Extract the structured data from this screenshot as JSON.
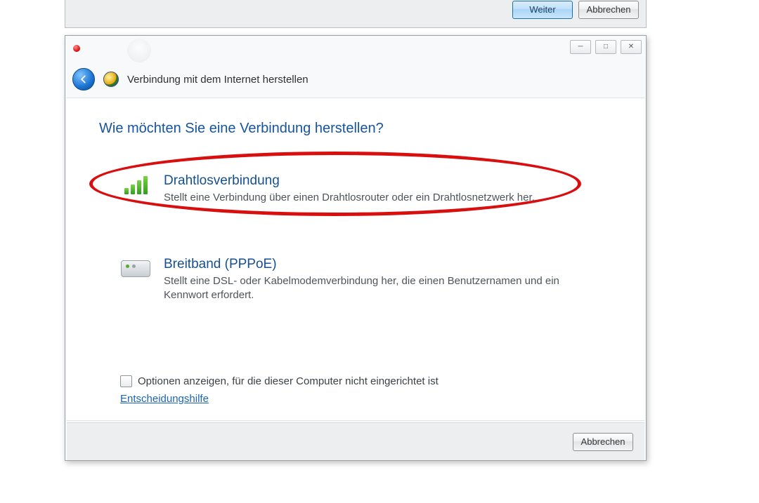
{
  "background_dialog": {
    "next_label": "Weiter",
    "cancel_label": "Abbrechen"
  },
  "wizard": {
    "title": "Verbindung mit dem Internet herstellen",
    "question": "Wie möchten Sie eine Verbindung herstellen?",
    "options": [
      {
        "id": "wireless",
        "title": "Drahtlosverbindung",
        "desc": "Stellt eine Verbindung über einen Drahtlosrouter oder ein Drahtlosnetzwerk her."
      },
      {
        "id": "pppoe",
        "title": "Breitband (PPPoE)",
        "desc": "Stellt eine DSL- oder Kabelmodemverbindung her, die einen Benutzernamen und ein Kennwort erfordert."
      }
    ],
    "checkbox_label": "Optionen anzeigen, für die dieser Computer nicht eingerichtet ist",
    "help_link": "Entscheidungshilfe",
    "cancel_label": "Abbrechen",
    "caption": {
      "min": "—",
      "max": "▢",
      "close": "✕"
    },
    "annotation": {
      "highlighted_option": "wireless"
    }
  }
}
